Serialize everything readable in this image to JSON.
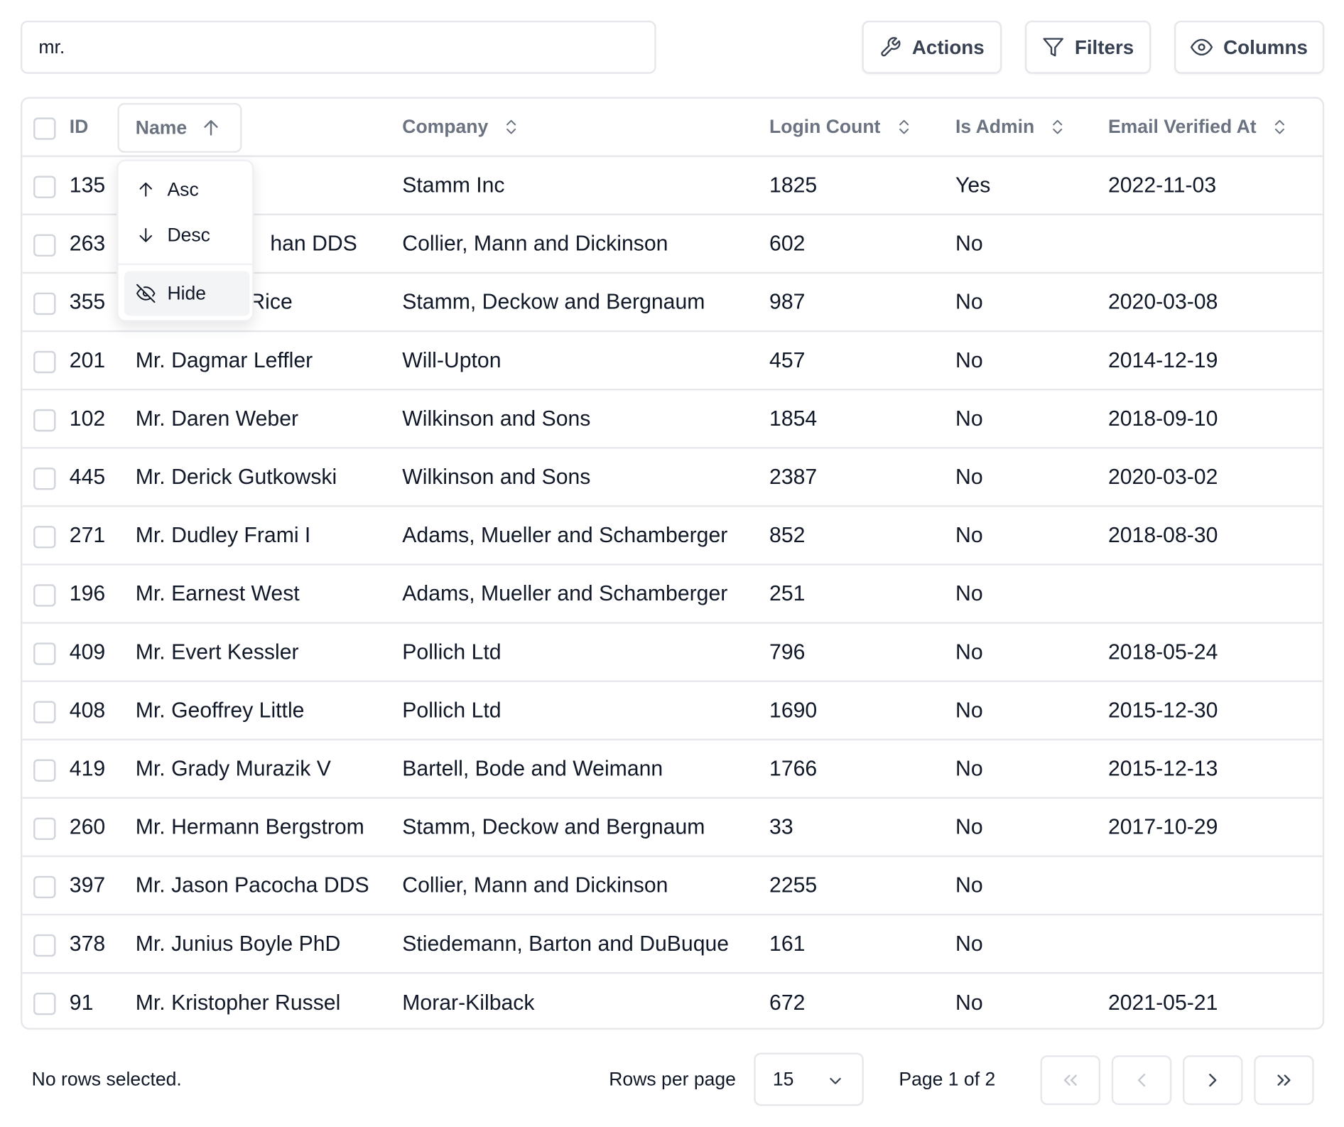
{
  "search": {
    "value": "mr."
  },
  "toolbar": {
    "actions_label": "Actions",
    "filters_label": "Filters",
    "columns_label": "Columns"
  },
  "table": {
    "headers": {
      "id": "ID",
      "name": "Name",
      "company": "Company",
      "login_count": "Login Count",
      "is_admin": "Is Admin",
      "email_verified_at": "Email Verified At"
    },
    "rows": [
      {
        "id": "135",
        "name": "",
        "company": "Stamm Inc",
        "login_count": "1825",
        "is_admin": "Yes",
        "email_verified_at": "2022-11-03"
      },
      {
        "id": "263",
        "name": "han DDS",
        "company": "Collier, Mann and Dickinson",
        "login_count": "602",
        "is_admin": "No",
        "email_verified_at": ""
      },
      {
        "id": "355",
        "name": "Rice",
        "company": "Stamm, Deckow and Bergnaum",
        "login_count": "987",
        "is_admin": "No",
        "email_verified_at": "2020-03-08"
      },
      {
        "id": "201",
        "name": "Mr. Dagmar Leffler",
        "company": "Will-Upton",
        "login_count": "457",
        "is_admin": "No",
        "email_verified_at": "2014-12-19"
      },
      {
        "id": "102",
        "name": "Mr. Daren Weber",
        "company": "Wilkinson and Sons",
        "login_count": "1854",
        "is_admin": "No",
        "email_verified_at": "2018-09-10"
      },
      {
        "id": "445",
        "name": "Mr. Derick Gutkowski",
        "company": "Wilkinson and Sons",
        "login_count": "2387",
        "is_admin": "No",
        "email_verified_at": "2020-03-02"
      },
      {
        "id": "271",
        "name": "Mr. Dudley Frami I",
        "company": "Adams, Mueller and Schamberger",
        "login_count": "852",
        "is_admin": "No",
        "email_verified_at": "2018-08-30"
      },
      {
        "id": "196",
        "name": "Mr. Earnest West",
        "company": "Adams, Mueller and Schamberger",
        "login_count": "251",
        "is_admin": "No",
        "email_verified_at": ""
      },
      {
        "id": "409",
        "name": "Mr. Evert Kessler",
        "company": "Pollich Ltd",
        "login_count": "796",
        "is_admin": "No",
        "email_verified_at": "2018-05-24"
      },
      {
        "id": "408",
        "name": "Mr. Geoffrey Little",
        "company": "Pollich Ltd",
        "login_count": "1690",
        "is_admin": "No",
        "email_verified_at": "2015-12-30"
      },
      {
        "id": "419",
        "name": "Mr. Grady Murazik V",
        "company": "Bartell, Bode and Weimann",
        "login_count": "1766",
        "is_admin": "No",
        "email_verified_at": "2015-12-13"
      },
      {
        "id": "260",
        "name": "Mr. Hermann Bergstrom",
        "company": "Stamm, Deckow and Bergnaum",
        "login_count": "33",
        "is_admin": "No",
        "email_verified_at": "2017-10-29"
      },
      {
        "id": "397",
        "name": "Mr. Jason Pacocha DDS",
        "company": "Collier, Mann and Dickinson",
        "login_count": "2255",
        "is_admin": "No",
        "email_verified_at": ""
      },
      {
        "id": "378",
        "name": "Mr. Junius Boyle PhD",
        "company": "Stiedemann, Barton and DuBuque",
        "login_count": "161",
        "is_admin": "No",
        "email_verified_at": ""
      },
      {
        "id": "91",
        "name": "Mr. Kristopher Russel",
        "company": "Morar-Kilback",
        "login_count": "672",
        "is_admin": "No",
        "email_verified_at": "2021-05-21"
      }
    ]
  },
  "sort_menu": {
    "asc_label": "Asc",
    "desc_label": "Desc",
    "hide_label": "Hide"
  },
  "footer": {
    "selected_text": "No rows selected.",
    "rows_per_page_label": "Rows per page",
    "rows_per_page_value": "15",
    "page_text": "Page 1 of 2"
  }
}
